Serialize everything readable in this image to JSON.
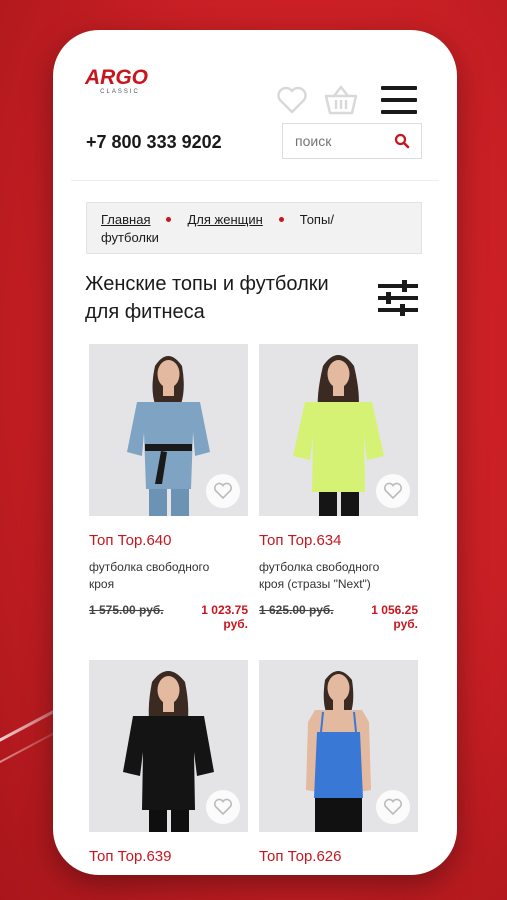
{
  "brand": {
    "name": "ARGO",
    "sub": "CLASSIC"
  },
  "header": {
    "phone": "+7 800 333 9202",
    "search_placeholder": "поиск"
  },
  "breadcrumb": {
    "home": "Главная",
    "women": "Для женщин",
    "current_1": "Топы/",
    "current_2": "футболки"
  },
  "page_title": "Женские топы и футболки для фитнеса",
  "colors": {
    "accent": "#c8161e",
    "background": "#c71f24"
  },
  "products": [
    {
      "title": "Топ Тор.640",
      "desc_1": "футболка свободного",
      "desc_2": "кроя",
      "old_price": "1 575.00 руб.",
      "new_price_1": "1 023.75",
      "new_price_2": "руб."
    },
    {
      "title": "Топ Тор.634",
      "desc_1": "футболка свободного",
      "desc_2": "кроя (стразы \"Next\")",
      "old_price": "1 625.00 руб.",
      "new_price_1": "1 056.25",
      "new_price_2": "руб."
    },
    {
      "title": "Топ Тор.639"
    },
    {
      "title": "Топ Тор.626"
    }
  ]
}
